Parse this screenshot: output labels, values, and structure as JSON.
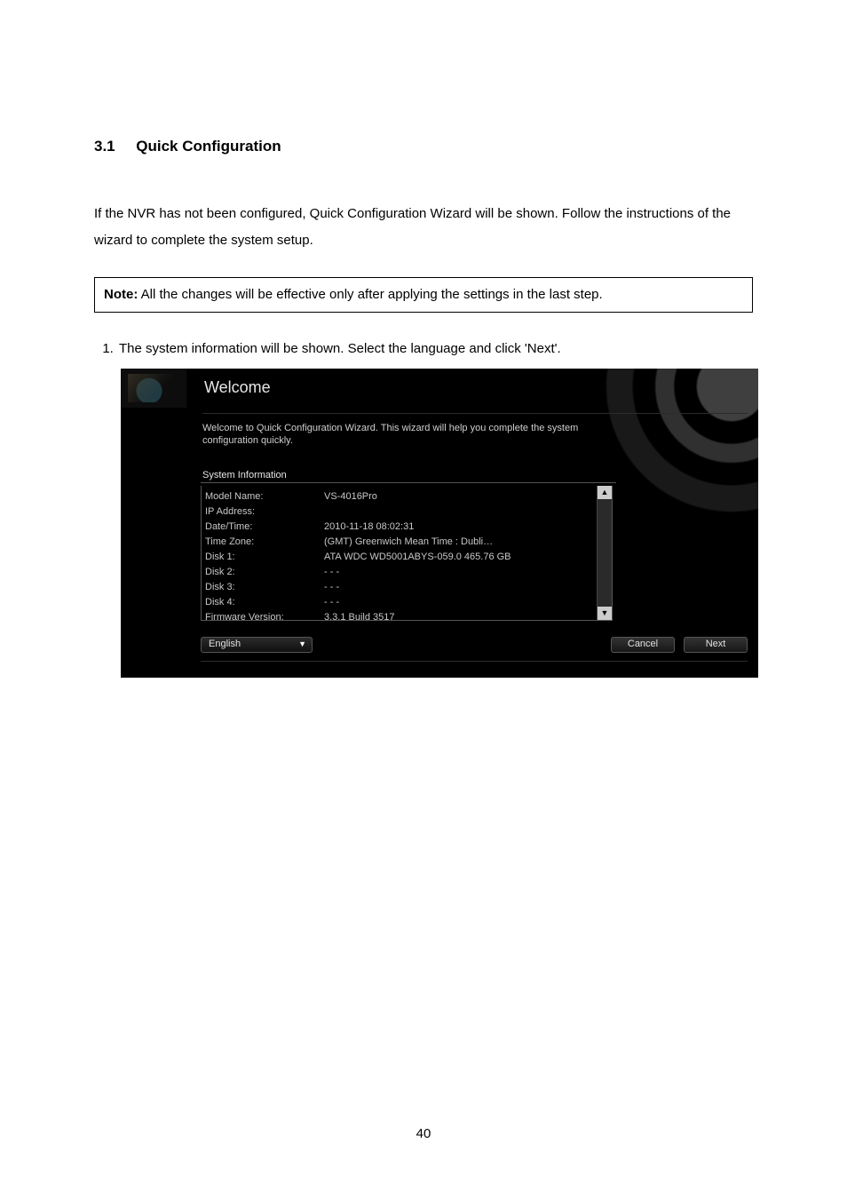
{
  "doc": {
    "section_number": "3.1",
    "section_title": "Quick Configuration",
    "body_para": "If the NVR has not been configured, Quick Configuration Wizard will be shown.   Follow the instructions of the wizard to complete the system setup.",
    "note_label": "Note:",
    "note_text": " All the changes will be effective only after applying the settings in the last step.",
    "step1": "The system information will be shown.   Select the language and click 'Next'.",
    "page_number": "40"
  },
  "shot": {
    "title": "Welcome",
    "intro_line1": "Welcome to Quick Configuration Wizard.  This wizard will help you complete the system",
    "intro_line2": "configuration quickly.",
    "info_heading": "System Information",
    "rows": {
      "model_name_k": "Model Name:",
      "model_name_v": "VS-4016Pro",
      "ip_k": "IP Address:",
      "ip_v": "",
      "dt_k": "Date/Time:",
      "dt_v": "2010-11-18 08:02:31",
      "tz_k": "Time Zone:",
      "tz_v": "(GMT) Greenwich Mean Time : Dubli…",
      "d1_k": "Disk 1:",
      "d1_v": "ATA     WDC WD5001ABYS-059.0      465.76 GB",
      "d2_k": "Disk 2:",
      "d2_v": "- - -",
      "d3_k": "Disk 3:",
      "d3_v": "- - -",
      "d4_k": "Disk 4:",
      "d4_v": "- - -",
      "fw_k": "Firmware Version:",
      "fw_v": "3.3.1 Build 3517"
    },
    "scroll_up": "▲",
    "scroll_down": "▼",
    "language": "English",
    "language_chevron": "▼",
    "cancel": "Cancel",
    "next": "Next"
  }
}
